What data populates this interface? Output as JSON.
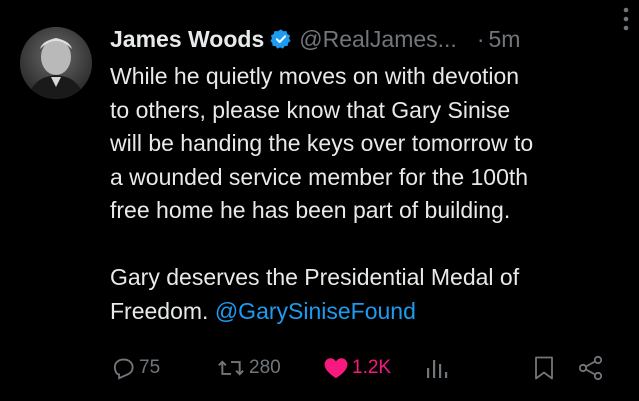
{
  "tweet": {
    "author": {
      "display_name": "James Woods",
      "handle": "@RealJames...",
      "verified_icon": "verified-badge-icon"
    },
    "separator": "·",
    "timestamp": "5m",
    "text_lines_para1": [
      "While he quietly moves on with devotion",
      "to others, please know that Gary Sinise",
      "will be handing the keys over tomorrow to",
      "a wounded service member for the 100th",
      "free home he has been part of building."
    ],
    "text_para2_line1": "Gary deserves the Presidential Medal of",
    "text_para2_line2_prefix": "Freedom. ",
    "mention": "@GarySiniseFound"
  },
  "actions": {
    "reply_count": "75",
    "repost_count": "280",
    "like_count": "1.2K"
  },
  "colors": {
    "background": "#000000",
    "text": "#e7e9ea",
    "muted": "#71767b",
    "link": "#1d9bf0",
    "like": "#f91880",
    "verified": "#1d9bf0"
  }
}
